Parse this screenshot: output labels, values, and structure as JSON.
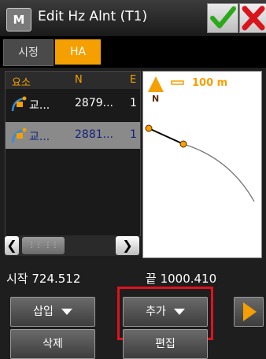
{
  "titlebar": {
    "app_icon": "M",
    "title": "Edit Hz Alnt (T1)",
    "ok_icon": "check-icon",
    "close_icon": "close-icon"
  },
  "tabs": [
    {
      "label": "시정"
    },
    {
      "label": "HA",
      "active": true
    }
  ],
  "list": {
    "columns": [
      "요소",
      "N",
      "E"
    ],
    "rows": [
      {
        "icon": "curve-element-icon",
        "cells": [
          "교...",
          "2879...",
          "1"
        ]
      },
      {
        "icon": "curve-element-icon",
        "cells": [
          "교...",
          "2881...",
          "1"
        ],
        "selected": true
      }
    ]
  },
  "map": {
    "north_label": "N",
    "scale_text": "100 m"
  },
  "station": {
    "start": "시작 724.512",
    "end": "끝 1000.410"
  },
  "buttons": {
    "insert": "삽입",
    "add": "추가",
    "delete": "삭제",
    "edit": "편집"
  },
  "colors": {
    "accent": "#f5a000",
    "highlight": "#e0121e",
    "selected_row": "#8a8a8a"
  }
}
